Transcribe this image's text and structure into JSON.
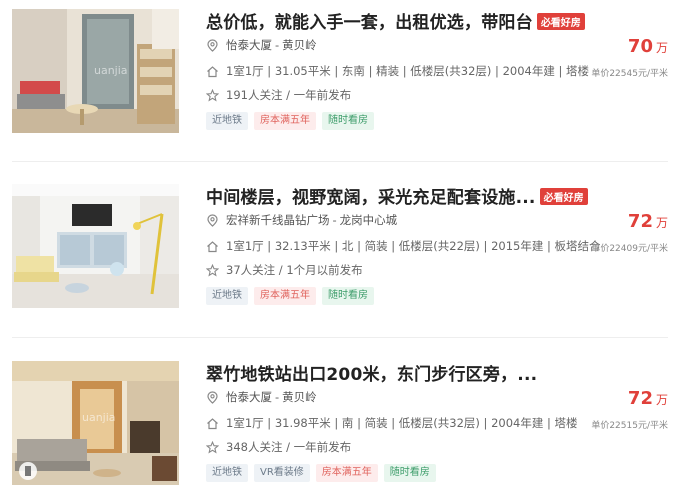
{
  "listings": [
    {
      "title": "总价低，就能入手一套，出租优选，带阳台",
      "badge": "必看好房",
      "community": "怡泰大厦",
      "area": "黄贝岭",
      "info": "1室1厅 | 31.05平米 | 东南 | 精装 | 低楼层(共32层) | 2004年建 | 塔楼",
      "follow": "191人关注 / 一年前发布",
      "tags": [
        {
          "label": "近地铁",
          "style": "gray"
        },
        {
          "label": "房本满五年",
          "style": "pink"
        },
        {
          "label": "随时看房",
          "style": "green"
        }
      ],
      "price": "70",
      "price_unit": "万",
      "unit_price": "单价22545元/平米"
    },
    {
      "title": "中间楼层，视野宽阔，采光充足配套设施...",
      "badge": "必看好房",
      "community": "宏祥新千线晶钻广场",
      "area": "龙岗中心城",
      "info": "1室1厅 | 32.13平米 | 北 | 简装 | 低楼层(共22层) | 2015年建 | 板塔结合",
      "follow": "37人关注 / 1个月以前发布",
      "tags": [
        {
          "label": "近地铁",
          "style": "gray"
        },
        {
          "label": "房本满五年",
          "style": "pink"
        },
        {
          "label": "随时看房",
          "style": "green"
        }
      ],
      "price": "72",
      "price_unit": "万",
      "unit_price": "单价22409元/平米"
    },
    {
      "title": "翠竹地铁站出口200米，东门步行区旁，...",
      "badge": "",
      "community": "怡泰大厦",
      "area": "黄贝岭",
      "info": "1室1厅 | 31.98平米 | 南 | 简装 | 低楼层(共32层) | 2004年建 | 塔楼",
      "follow": "348人关注 / 一年前发布",
      "tags": [
        {
          "label": "近地铁",
          "style": "gray"
        },
        {
          "label": "VR看装修",
          "style": "gray"
        },
        {
          "label": "房本满五年",
          "style": "pink"
        },
        {
          "label": "随时看房",
          "style": "green"
        }
      ],
      "price": "72",
      "price_unit": "万",
      "unit_price": "单价22515元/平米"
    }
  ],
  "watermark": "uanjia",
  "colors": {
    "accent": "#e0403a",
    "badge_bg": "#e0403a"
  },
  "icons": {
    "location": "location-pin-icon",
    "house": "house-icon",
    "star": "star-icon"
  }
}
